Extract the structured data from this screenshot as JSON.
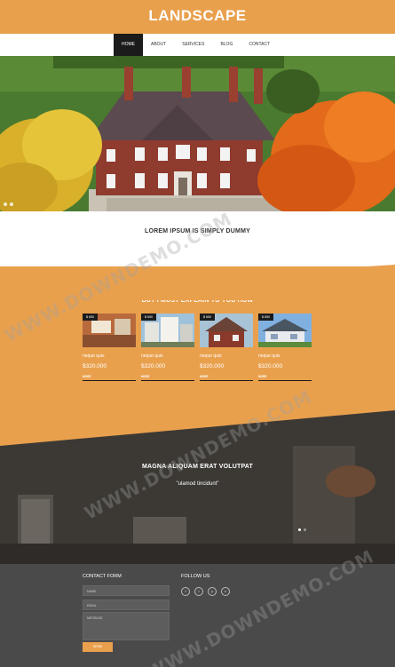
{
  "header": {
    "logo": "LANDSCAPE",
    "contact_line1": "",
    "contact_line2": "",
    "contact_line3": "",
    "contact_line4": "",
    "bg_color": "#e9a04d"
  },
  "nav": {
    "items": [
      {
        "label": "HOME"
      },
      {
        "label": "ABOUT"
      },
      {
        "label": "SERVICES"
      },
      {
        "label": "BLOG"
      },
      {
        "label": "CONTACT"
      }
    ],
    "active_index": 0
  },
  "intro": {
    "title": "LOREM IPSUM IS SIMPLY DUMMY",
    "text": ""
  },
  "featured": {
    "title": "BUT I MUST EXPLAIN TO YOU HOW",
    "cards": [
      {
        "tag": "$ 650",
        "title": "neque quis",
        "desc": "",
        "price": "$320.000",
        "more": "MORE"
      },
      {
        "tag": "$ 650",
        "title": "neque quis",
        "desc": "",
        "price": "$320.000",
        "more": "MORE"
      },
      {
        "tag": "$ 650",
        "title": "neque quis",
        "desc": "",
        "price": "$320.000",
        "more": "MORE"
      },
      {
        "tag": "$ 650",
        "title": "neque quis",
        "desc": "",
        "price": "$320.000",
        "more": "MORE"
      }
    ]
  },
  "testimonial": {
    "title": "MAGNA ALIQUAM ERAT VOLUTPAT",
    "quote_title": "\"ulamod tincidunt\"",
    "text": "",
    "author": ""
  },
  "footer": {
    "contact_title": "CONTACT FORM",
    "name_placeholder": "NAME",
    "email_placeholder": "EMAIL",
    "message_placeholder": "MESSAGE",
    "send_label": "SEND",
    "follow_title": "FOLLOW US",
    "social_icons": [
      "facebook-icon",
      "twitter-icon",
      "pinterest-icon",
      "skype-icon"
    ],
    "text": "",
    "copyright": ""
  },
  "watermark": "WWW.DOWNDEMO.COM"
}
